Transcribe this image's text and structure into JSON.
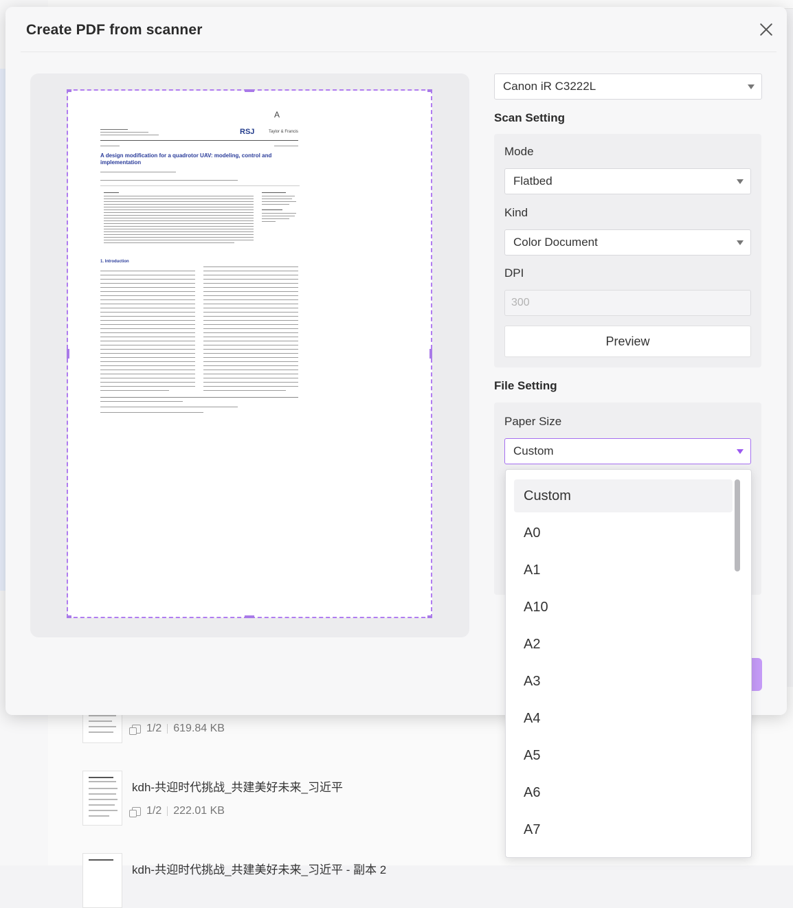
{
  "background": {
    "files": [
      {
        "name": "",
        "pages": "1/2",
        "size": "619.84 KB"
      },
      {
        "name": "kdh-共迎时代挑战_共建美好未来_习近平",
        "pages": "1/2",
        "size": "222.01 KB"
      },
      {
        "name": "kdh-共迎时代挑战_共建美好未来_习近平 - 副本 2",
        "pages": "",
        "size": ""
      }
    ]
  },
  "dialog": {
    "title": "Create PDF from scanner",
    "scanner": "Canon iR C3222L",
    "scan_setting": {
      "title": "Scan Setting",
      "mode_label": "Mode",
      "mode_value": "Flatbed",
      "kind_label": "Kind",
      "kind_value": "Color Document",
      "dpi_label": "DPI",
      "dpi_placeholder": "300",
      "preview_button": "Preview"
    },
    "file_setting": {
      "title": "File Setting",
      "paper_size_label": "Paper Size",
      "paper_size_value": "Custom",
      "paper_size_options": [
        "Custom",
        "A0",
        "A1",
        "A10",
        "A2",
        "A3",
        "A4",
        "A5",
        "A6",
        "A7"
      ]
    },
    "preview_document": {
      "title": "A design modification for a quadrotor UAV: modeling, control and implementation",
      "journal_logo": "RSJ",
      "publisher": "Taylor & Francis",
      "section": "1. Introduction",
      "mark": "A"
    }
  },
  "colors": {
    "accent": "#a56ff0",
    "crop_frame": "#b07cf0",
    "title_link": "#2a3c9a"
  }
}
